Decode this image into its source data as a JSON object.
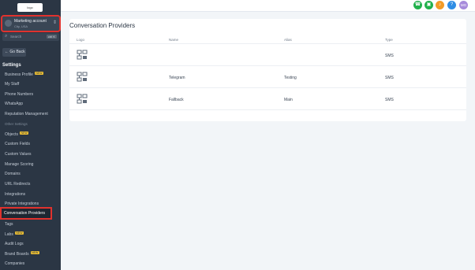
{
  "sidebar": {
    "logo": "logo",
    "account": {
      "name": "Marketing account",
      "sub": "City, USA"
    },
    "search": {
      "placeholder": "Search",
      "shortcut": "ctrl K"
    },
    "go_back": "← Go Back",
    "settings_heading": "Settings",
    "items": [
      {
        "label": "Business Profile",
        "badge": "NEW"
      },
      {
        "label": "My Staff"
      },
      {
        "label": "Phone Numbers"
      },
      {
        "label": "WhatsApp"
      },
      {
        "label": "Reputation Management"
      },
      {
        "label": "Other Settings",
        "section": true
      },
      {
        "label": "Objects",
        "badge": "NEW"
      },
      {
        "label": "Custom Fields"
      },
      {
        "label": "Custom Values"
      },
      {
        "label": "Manage Scoring"
      },
      {
        "label": "Domains"
      },
      {
        "label": "URL Redirects"
      },
      {
        "label": "Integrations"
      },
      {
        "label": "Private Integrations"
      },
      {
        "label": "Conversation Providers",
        "active": true
      },
      {
        "label": "Tags"
      },
      {
        "label": "Labs",
        "badge": "NEW"
      },
      {
        "label": "Audit Logs"
      },
      {
        "label": "Brand Boards",
        "badge": "NEW"
      },
      {
        "label": "Companies"
      }
    ]
  },
  "topbar": {
    "icons": [
      {
        "name": "phone-icon",
        "glyph": "☎",
        "color": "#22b14c"
      },
      {
        "name": "shop-icon",
        "glyph": "▣",
        "color": "#22b14c"
      },
      {
        "name": "bell-icon",
        "glyph": "♪",
        "color": "#f39b27"
      },
      {
        "name": "help-icon",
        "glyph": "?",
        "color": "#2f8de4"
      },
      {
        "name": "user-avatar-icon",
        "glyph": "MG",
        "color": "#a78bdb"
      }
    ]
  },
  "main": {
    "title": "Conversation Providers",
    "columns": [
      "Logo",
      "Name",
      "Alias",
      "Type"
    ],
    "rows": [
      {
        "name": "",
        "alias": "",
        "type": "SMS"
      },
      {
        "name": "Telegram",
        "alias": "Testing",
        "type": "SMS"
      },
      {
        "name": "Fallback",
        "alias": "Main",
        "type": "SMS"
      }
    ]
  }
}
